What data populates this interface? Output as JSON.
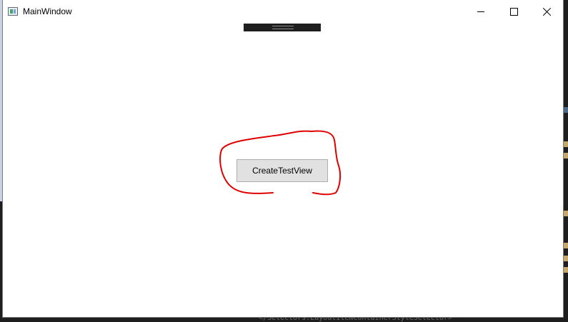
{
  "window": {
    "title": "MainWindow"
  },
  "caption_buttons": {
    "minimize": "minimize",
    "maximize": "maximize",
    "close": "close"
  },
  "content": {
    "button_label": "CreateTestView"
  },
  "annotation": {
    "color": "#e00000",
    "shape": "freehand circle around button"
  },
  "background": {
    "code_snippet": "</Selectors:LayoutItemContainerStyleSelector>"
  }
}
